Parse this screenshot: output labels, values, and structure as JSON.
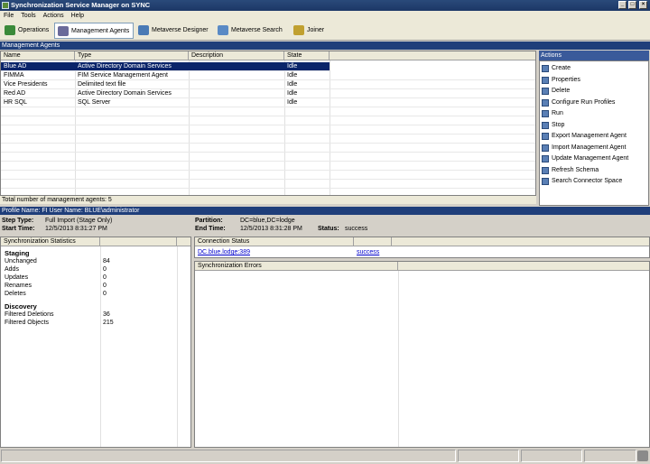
{
  "window": {
    "title": "Synchronization Service Manager on SYNC"
  },
  "menu": [
    "File",
    "Tools",
    "Actions",
    "Help"
  ],
  "toolbar": [
    {
      "label": "Operations",
      "icon": "operations-icon",
      "color": "#3a8a3a"
    },
    {
      "label": "Management Agents",
      "icon": "management-agents-icon",
      "color": "#6a6a9a"
    },
    {
      "label": "Metaverse Designer",
      "icon": "metaverse-designer-icon",
      "color": "#4a7ab5"
    },
    {
      "label": "Metaverse Search",
      "icon": "metaverse-search-icon",
      "color": "#5a8ac5"
    },
    {
      "label": "Joiner",
      "icon": "joiner-icon",
      "color": "#c0a030"
    }
  ],
  "ma_panel": {
    "title": "Management Agents",
    "columns": [
      "Name",
      "Type",
      "Description",
      "State"
    ],
    "rows": [
      {
        "name": "Blue AD",
        "type": "Active Directory Domain Services",
        "description": "",
        "state": "Idle"
      },
      {
        "name": "FIMMA",
        "type": "FIM Service Management Agent",
        "description": "",
        "state": "Idle"
      },
      {
        "name": "Vice Presidents",
        "type": "Delimited text file",
        "description": "",
        "state": "Idle"
      },
      {
        "name": "Red AD",
        "type": "Active Directory Domain Services",
        "description": "",
        "state": "Idle"
      },
      {
        "name": "HR SQL",
        "type": "SQL Server",
        "description": "",
        "state": "Idle"
      }
    ],
    "footer": "Total number of management agents: 5"
  },
  "actions": {
    "title": "Actions",
    "items": [
      "Create",
      "Properties",
      "Delete",
      "Configure Run Profiles",
      "Run",
      "Stop",
      "Export Management Agent",
      "Import Management Agent",
      "Update Management Agent",
      "Refresh Schema",
      "Search Connector Space"
    ]
  },
  "profile": {
    "header": "Profile Name: FI  User Name: BLUE\\administrator",
    "step_type_label": "Step Type:",
    "step_type": "Full Import (Stage Only)",
    "start_time_label": "Start Time:",
    "start_time": "12/5/2013 8:31:27 PM",
    "partition_label": "Partition:",
    "partition": "DC=blue,DC=lodge",
    "end_time_label": "End Time:",
    "end_time": "12/5/2013 8:31:28 PM",
    "status_label": "Status:",
    "status": "success"
  },
  "sync_stats": {
    "title": "Synchronization Statistics",
    "staging_heading": "Staging",
    "staging": [
      {
        "k": "Unchanged",
        "v": "84"
      },
      {
        "k": "Adds",
        "v": "0"
      },
      {
        "k": "Updates",
        "v": "0"
      },
      {
        "k": "Renames",
        "v": "0"
      },
      {
        "k": "Deletes",
        "v": "0"
      }
    ],
    "discovery_heading": "Discovery",
    "discovery": [
      {
        "k": "Filtered Deletions",
        "v": "36"
      },
      {
        "k": "Filtered Objects",
        "v": "215"
      }
    ]
  },
  "connection": {
    "title": "Connection Status",
    "server": "DC.blue.lodge:389",
    "result": "success"
  },
  "sync_errors": {
    "title": "Synchronization Errors"
  }
}
